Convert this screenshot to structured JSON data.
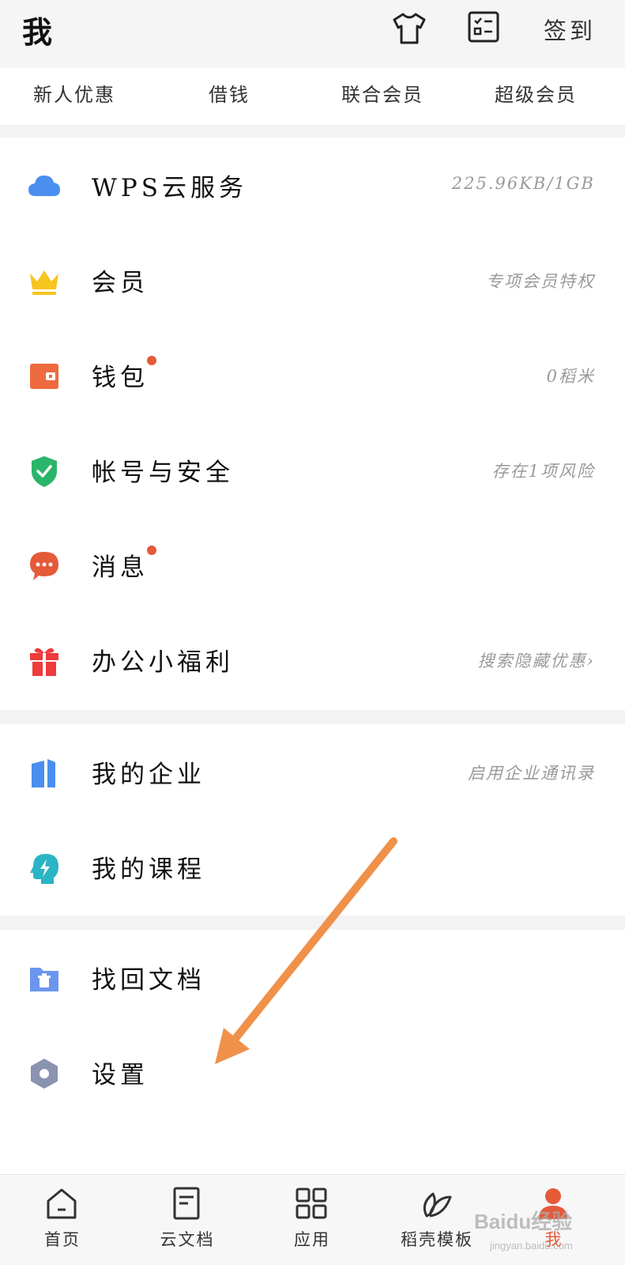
{
  "header": {
    "title": "我",
    "shirt_icon": "t-shirt-icon",
    "checklist_icon": "checklist-icon",
    "signin_label": "签到"
  },
  "quick_links": [
    "新人优惠",
    "借钱",
    "联合会员",
    "超级会员"
  ],
  "menu": [
    {
      "label": "WPS云服务",
      "value": "225.96KB/1GB",
      "icon": "cloud-icon",
      "color": "#4a8ff0",
      "dot": false
    },
    {
      "label": "会员",
      "value": "专项会员特权",
      "icon": "crown-icon",
      "color": "#f7c51e",
      "dot": false
    },
    {
      "label": "钱包",
      "value": "0稻米",
      "icon": "wallet-icon",
      "color": "#ef6a3f",
      "dot": true
    },
    {
      "label": "帐号与安全",
      "value": "存在1项风险",
      "icon": "shield-icon",
      "color": "#2bb56a",
      "dot": false
    },
    {
      "label": "消息",
      "value": "",
      "icon": "message-icon",
      "color": "#e55a39",
      "dot": true
    },
    {
      "label": "办公小福利",
      "value": "搜索隐藏优惠›",
      "icon": "gift-icon",
      "color": "#ee3b3b",
      "dot": false
    },
    {
      "label": "我的企业",
      "value": "启用企业通讯录",
      "icon": "enterprise-icon",
      "color": "#4a8ff0",
      "dot": false
    },
    {
      "label": "我的课程",
      "value": "",
      "icon": "course-icon",
      "color": "#2bb4c4",
      "dot": false
    },
    {
      "label": "找回文档",
      "value": "",
      "icon": "recover-folder-icon",
      "color": "#6b95ef",
      "dot": false
    },
    {
      "label": "设置",
      "value": "",
      "icon": "settings-icon",
      "color": "#8a93b0",
      "dot": false
    }
  ],
  "bottom_nav": [
    {
      "label": "首页",
      "icon": "home-icon",
      "active": false
    },
    {
      "label": "云文档",
      "icon": "document-icon",
      "active": false
    },
    {
      "label": "应用",
      "icon": "apps-grid-icon",
      "active": false
    },
    {
      "label": "稻壳模板",
      "icon": "leaf-icon",
      "active": false
    },
    {
      "label": "我",
      "icon": "profile-icon",
      "active": true
    }
  ],
  "colors": {
    "accent": "#e55a39",
    "annotation_arrow": "#f0914a"
  },
  "watermark": {
    "text": "Baidu经验",
    "sub": "jingyan.baidu.com"
  }
}
